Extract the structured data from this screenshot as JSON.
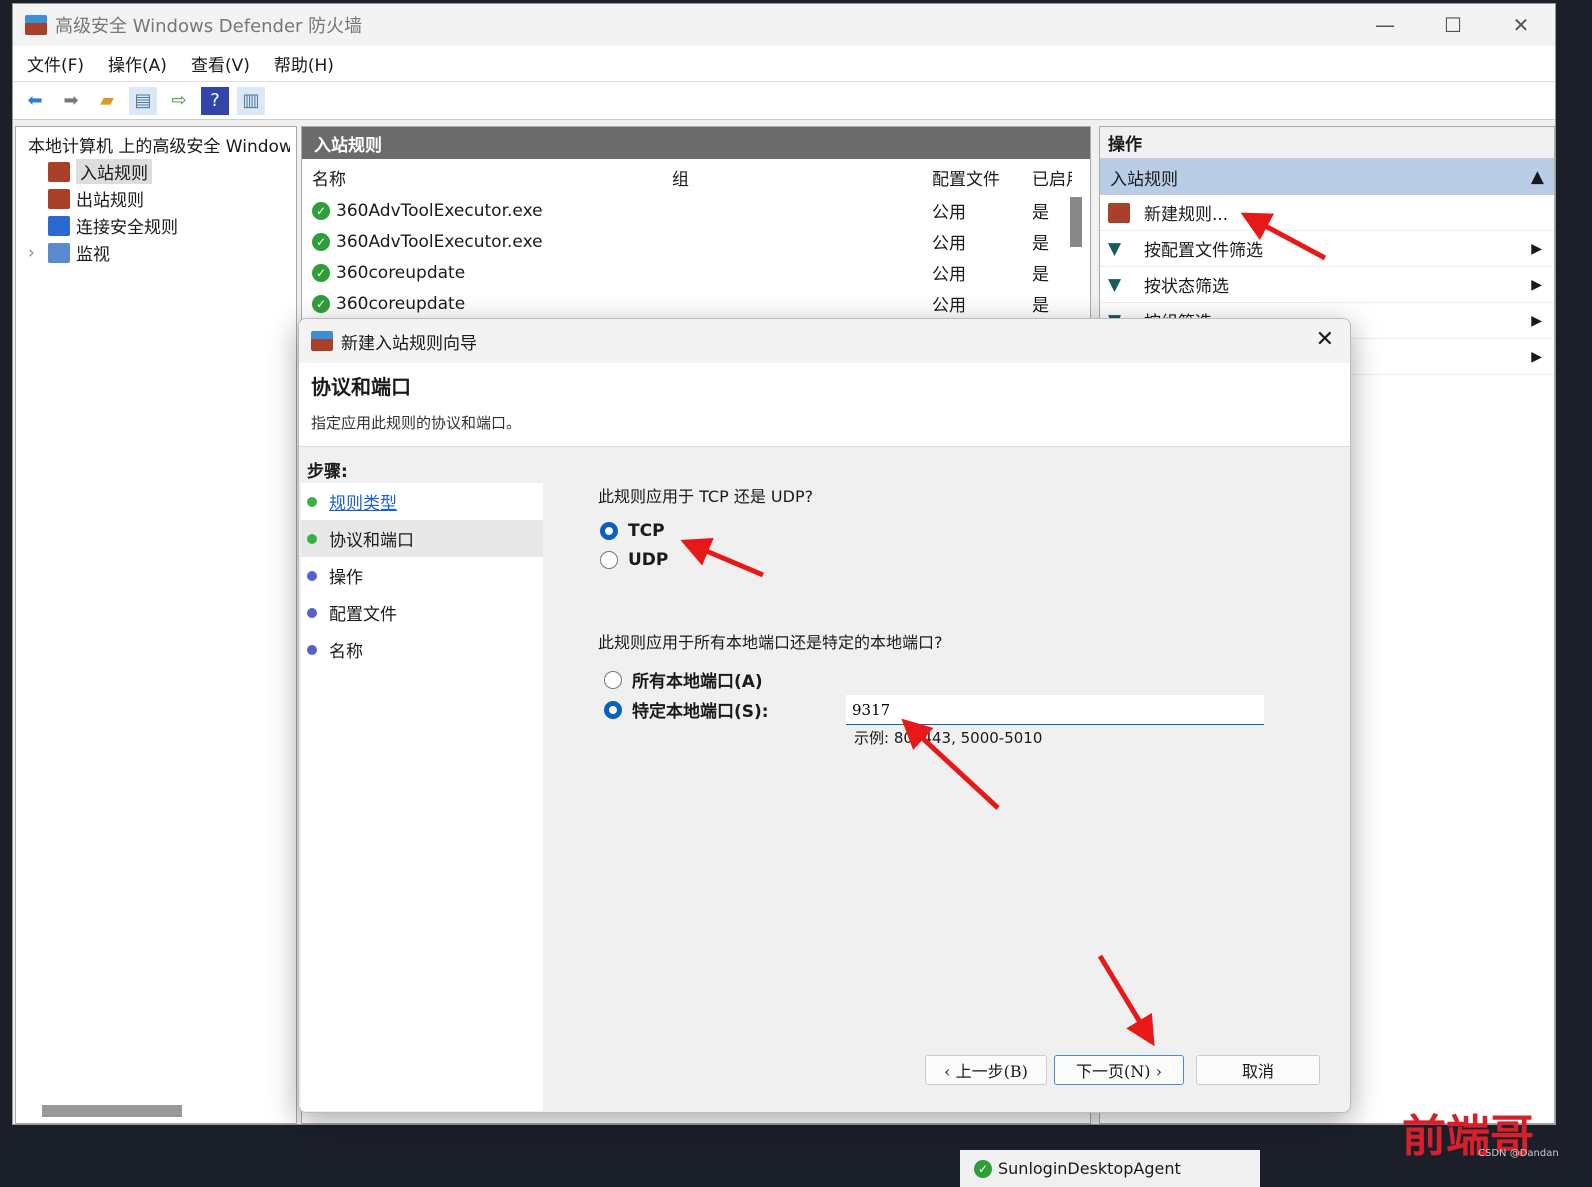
{
  "window": {
    "title": "高级安全 Windows Defender 防火墙",
    "minimize": "—",
    "maximize": "☐",
    "close": "✕"
  },
  "menu": [
    "文件(F)",
    "操作(A)",
    "查看(V)",
    "帮助(H)"
  ],
  "tree": {
    "root": "本地计算机 上的高级安全 Windows Defender 防火墙",
    "items": [
      "入站规则",
      "出站规则",
      "连接安全规则",
      "监视"
    ],
    "expander": "›"
  },
  "middle": {
    "title": "入站规则",
    "columns": [
      "名称",
      "组",
      "配置文件",
      "已启用"
    ],
    "rows": [
      {
        "name": "360AdvToolExecutor.exe",
        "group": "",
        "profile": "公用",
        "enabled": "是"
      },
      {
        "name": "360AdvToolExecutor.exe",
        "group": "",
        "profile": "公用",
        "enabled": "是"
      },
      {
        "name": "360coreupdate",
        "group": "",
        "profile": "公用",
        "enabled": "是"
      },
      {
        "name": "360coreupdate",
        "group": "",
        "profile": "公用",
        "enabled": "是"
      }
    ],
    "bottom_row": "SunloginDesktopAgent"
  },
  "actions": {
    "title": "操作",
    "section": "入站规则",
    "items": [
      "新建规则...",
      "按配置文件筛选",
      "按状态筛选",
      "按组筛选"
    ]
  },
  "dialog": {
    "title": "新建入站规则向导",
    "heading": "协议和端口",
    "subheading": "指定应用此规则的协议和端口。",
    "steps_label": "步骤:",
    "steps": [
      {
        "label": "规则类型",
        "state": "link"
      },
      {
        "label": "协议和端口",
        "state": "current"
      },
      {
        "label": "操作",
        "state": "pending"
      },
      {
        "label": "配置文件",
        "state": "pending"
      },
      {
        "label": "名称",
        "state": "pending"
      }
    ],
    "q1": "此规则应用于 TCP 还是 UDP?",
    "protocols": [
      {
        "label": "TCP",
        "selected": true
      },
      {
        "label": "UDP",
        "selected": false
      }
    ],
    "q2": "此规则应用于所有本地端口还是特定的本地端口?",
    "ports": [
      {
        "label": "所有本地端口(A)",
        "selected": false
      },
      {
        "label": "特定本地端口(S):",
        "selected": true
      }
    ],
    "port_value": "9317",
    "example": "示例: 80, 443, 5000-5010",
    "buttons": {
      "back": "‹ 上一步(B)",
      "next": "下一页(N) ›",
      "cancel": "取消"
    }
  },
  "watermark": "前端哥",
  "credit": "CSDN @Dandan",
  "colors": {
    "annotation": "#e81818",
    "accent": "#0a5fc4",
    "selection": "#b9cde6"
  }
}
